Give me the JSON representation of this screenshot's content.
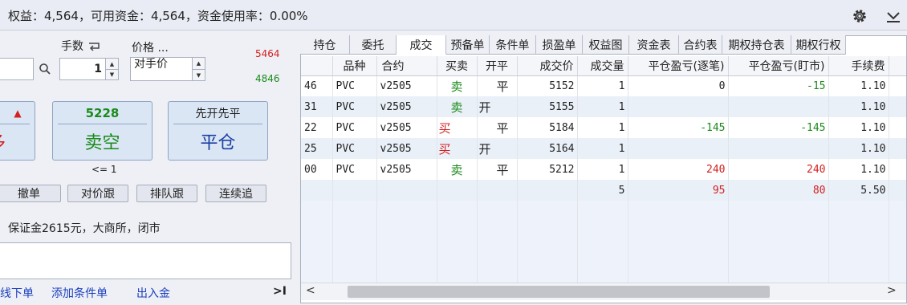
{
  "topbar": {
    "account_summary": "权益：4,564，可用资金：4,564，资金使用率：0.00%",
    "icons": [
      "gear-icon",
      "chevron-down-icon"
    ]
  },
  "order_panel": {
    "qty_label": "手数",
    "price_label": "价格 ...",
    "qty_value": "1",
    "price_value": "对手价",
    "limit_up": "5464",
    "limit_down": "4846",
    "buy_partial_label": "多",
    "sell_price": "5228",
    "sell_label": "卖空",
    "close_top_label": "先开先平",
    "close_label": "平仓",
    "max_qty_hint": "<= 1",
    "buttons": [
      "撤单",
      "对价跟",
      "排队跟",
      "连续追"
    ],
    "info_text": "保证金2615元，大商所，闭市",
    "links": [
      "线下单",
      "添加条件单",
      "出入金"
    ],
    "collapse_label": ">I",
    "colors": {
      "up": "#d32020",
      "down": "#1a8a1a",
      "accent": "#1a3fbf"
    }
  },
  "tabs": [
    "持仓",
    "委托",
    "成交",
    "预备单",
    "条件单",
    "损盈单",
    "权益图",
    "资金表",
    "合约表",
    "期权持仓表",
    "期权行权"
  ],
  "active_tab": "成交",
  "trades_table": {
    "headers": [
      "",
      "品种",
      "合约",
      "买卖",
      "开平",
      "成交价",
      "成交量",
      "平仓盈亏(逐笔)",
      "平仓盈亏(盯市)",
      "手续费"
    ],
    "rows": [
      {
        "id": "46",
        "product": "PVC",
        "contract": "v2505",
        "side": "卖",
        "offset": "平",
        "price": "5152",
        "volume": "1",
        "pnl_trade": "0",
        "pnl_mtm": "-15",
        "fee": "1.10"
      },
      {
        "id": "31",
        "product": "PVC",
        "contract": "v2505",
        "side": "卖",
        "offset": "开",
        "price": "5155",
        "volume": "1",
        "pnl_trade": "",
        "pnl_mtm": "",
        "fee": "1.10"
      },
      {
        "id": "22",
        "product": "PVC",
        "contract": "v2505",
        "side": "买",
        "offset": "平",
        "price": "5184",
        "volume": "1",
        "pnl_trade": "-145",
        "pnl_mtm": "-145",
        "fee": "1.10"
      },
      {
        "id": "25",
        "product": "PVC",
        "contract": "v2505",
        "side": "买",
        "offset": "开",
        "price": "5164",
        "volume": "1",
        "pnl_trade": "",
        "pnl_mtm": "",
        "fee": "1.10"
      },
      {
        "id": "00",
        "product": "PVC",
        "contract": "v2505",
        "side": "卖",
        "offset": "平",
        "price": "5212",
        "volume": "1",
        "pnl_trade": "240",
        "pnl_mtm": "240",
        "fee": "1.10"
      }
    ],
    "totals": {
      "volume": "5",
      "pnl_trade": "95",
      "pnl_mtm": "80",
      "fee": "5.50"
    }
  },
  "scrollbar": {
    "left_arrow": "<",
    "right_arrow": ">"
  }
}
